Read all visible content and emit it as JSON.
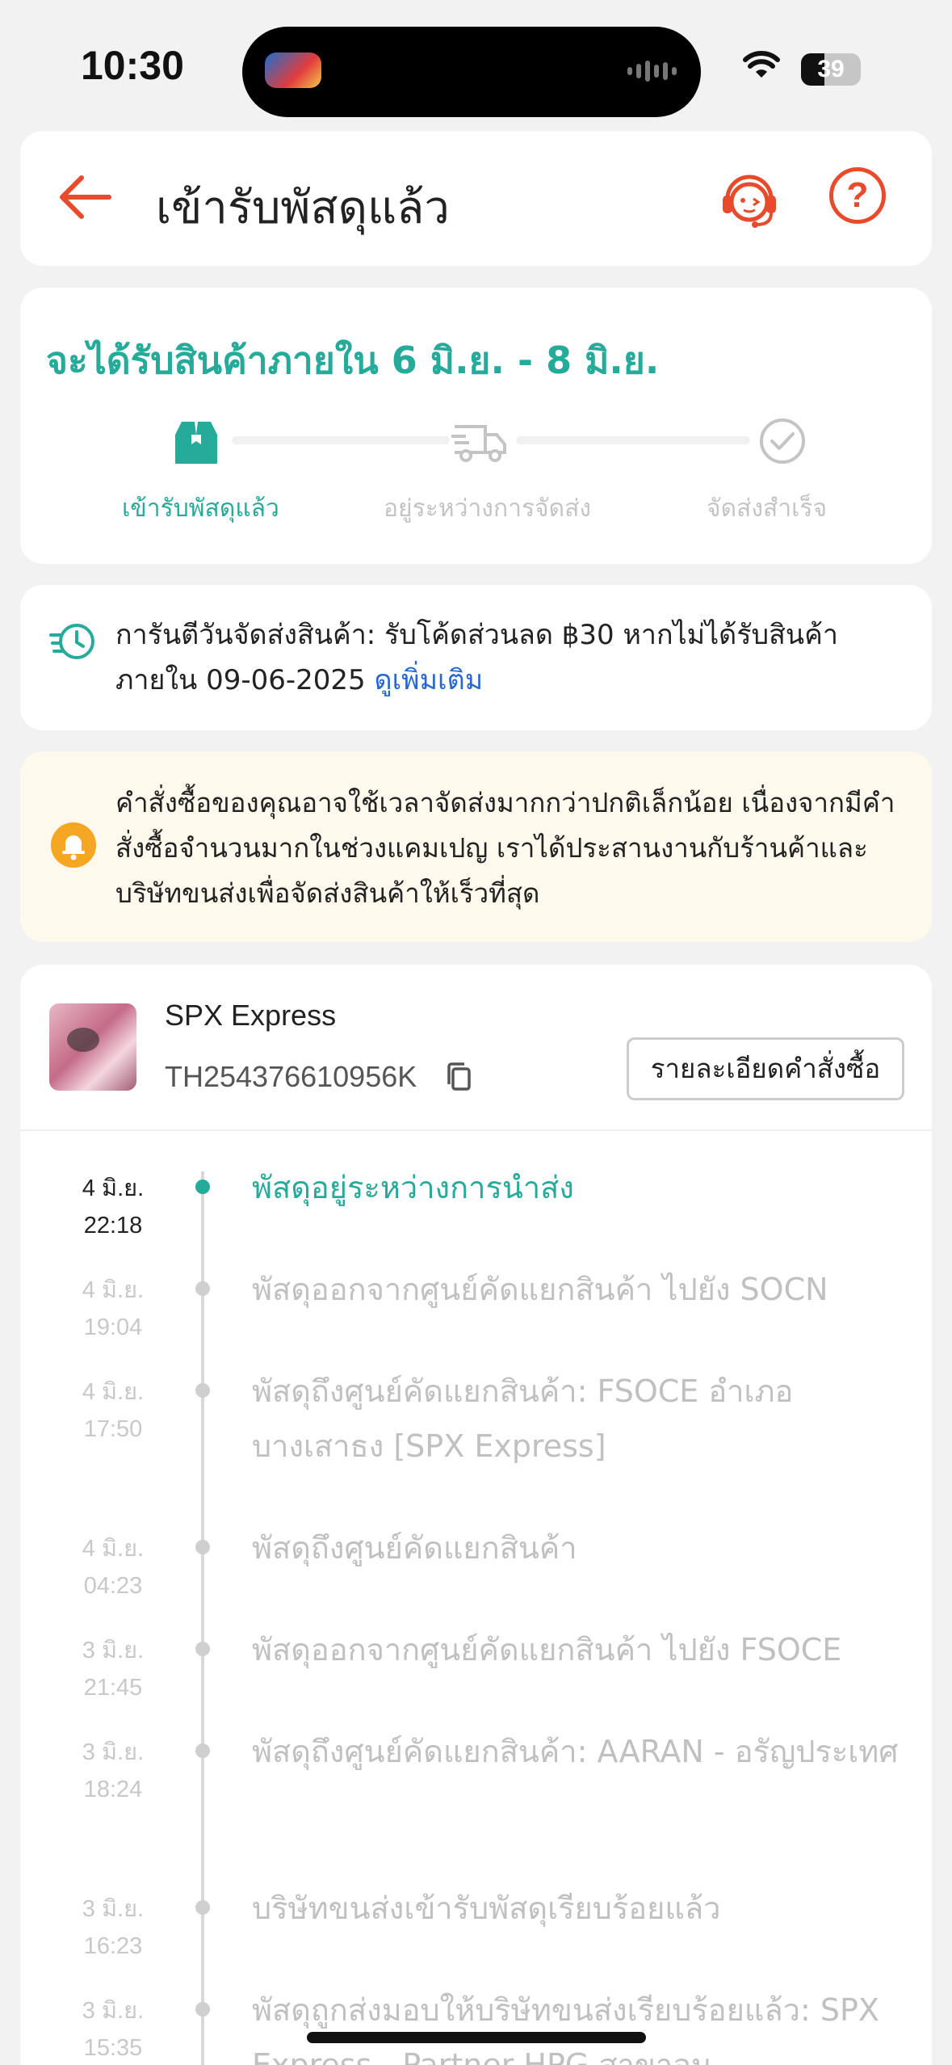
{
  "status_bar": {
    "time": "10:30",
    "battery": "39",
    "battery_level": 0.39
  },
  "header": {
    "title": "เข้ารับพัสดุแล้ว"
  },
  "estimate": {
    "title": "จะได้รับสินค้าภายใน 6 มิ.ย. - 8 มิ.ย.",
    "steps": [
      {
        "label": "เข้ารับพัสดุแล้ว",
        "state": "done",
        "icon": "package-icon"
      },
      {
        "label": "อยู่ระหว่างการจัดส่ง",
        "state": "pending",
        "icon": "truck-icon"
      },
      {
        "label": "จัดส่งสำเร็จ",
        "state": "pending",
        "icon": "check-circle-icon"
      }
    ]
  },
  "guarantee": {
    "text": "การันตีวันจัดส่งสินค้า: รับโค้ดส่วนลด ฿30 หากไม่ได้รับสินค้าภายใน 09-06-2025 ",
    "link": "ดูเพิ่มเติม"
  },
  "notice": {
    "text": "คำสั่งซื้อของคุณอาจใช้เวลาจัดส่งมากกว่าปกติเล็กน้อย เนื่องจากมีคำสั่งซื้อจำนวนมากในช่วงแคมเปญ เราได้ประสานงานกับร้านค้าและบริษัทขนส่งเพื่อจัดส่งสินค้าให้เร็วที่สุด"
  },
  "shipment": {
    "carrier": "SPX Express",
    "tracking_number": "TH254376610956K",
    "order_detail_label": "รายละเอียดคำสั่งซื้อ"
  },
  "events": [
    {
      "date": "4 มิ.ย.",
      "time": "22:18",
      "text": "พัสดุอยู่ระหว่างการนำส่ง",
      "current": true
    },
    {
      "date": "4 มิ.ย.",
      "time": "19:04",
      "text": "พัสดุออกจากศูนย์คัดแยกสินค้า ไปยัง SOCN"
    },
    {
      "date": "4 มิ.ย.",
      "time": "17:50",
      "text": "พัสดุถึงศูนย์คัดแยกสินค้า: FSOCE อำเภอบางเสาธง [SPX Express]"
    },
    {
      "date": "4 มิ.ย.",
      "time": "04:23",
      "text": "พัสดุถึงศูนย์คัดแยกสินค้า"
    },
    {
      "date": "3 มิ.ย.",
      "time": "21:45",
      "text": "พัสดุออกจากศูนย์คัดแยกสินค้า ไปยัง FSOCE"
    },
    {
      "date": "3 มิ.ย.",
      "time": "18:24",
      "text": "พัสดุถึงศูนย์คัดแยกสินค้า: AARAN - อรัญประเทศ"
    },
    {
      "date": "3 มิ.ย.",
      "time": "16:23",
      "text": "บริษัทขนส่งเข้ารับพัสดุเรียบร้อยแล้ว"
    },
    {
      "date": "3 มิ.ย.",
      "time": "15:35",
      "text": "พัสดุถูกส่งมอบให้บริษัทขนส่งเรียบร้อยแล้ว: SPX Express - Partner HPG สาขาอนุ"
    }
  ],
  "colors": {
    "accent": "#26aa99",
    "brand": "#e84b2b",
    "link": "#2767d2",
    "notice_bg": "#fff8ec"
  }
}
